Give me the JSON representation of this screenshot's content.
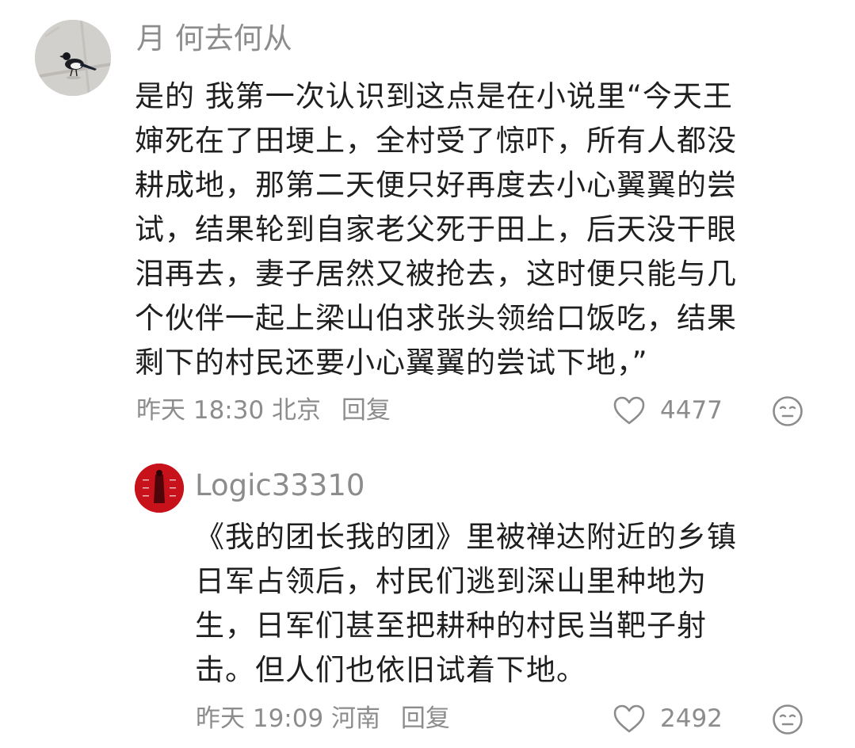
{
  "comment": {
    "username": "月 何去何从",
    "lines": [
      "是的 我第一次认识到这点是在小说里“今天王",
      "婶死在了田埂上，全村受了惊吓，所有人都没",
      "耕成地，那第二天便只好再度去小心翼翼的尝",
      "试，结果轮到自家老父死于田上，后天没干眼",
      "泪再去，妻子居然又被抢去，这时便只能与几",
      "个伙伴一起上梁山伯求张头领给口饭吃，结果",
      "剩下的村民还要小心翼翼的尝试下地，”"
    ],
    "time": "昨天 18:30 北京",
    "reply_label": "回复",
    "like_count": "4477",
    "avatar": "magpie-photo"
  },
  "reply": {
    "username": "Logic33310",
    "lines": [
      "《我的团长我的团》里被禅达附近的乡镇",
      "日军占领后，村民们逃到深山里种地为",
      "生，日军们甚至把耕种的村民当靶子射",
      "击。但人们也依旧试着下地。"
    ],
    "time": "昨天 19:09 河南",
    "reply_label": "回复",
    "like_count": "2492",
    "avatar": "red-album-cover"
  },
  "icons": {
    "like": "heart-outline-icon",
    "reaction": "neutral-face-icon"
  },
  "colors": {
    "text": "#1f1f1f",
    "muted": "#8c8c8c",
    "reply_avatar": "#c8121b"
  }
}
